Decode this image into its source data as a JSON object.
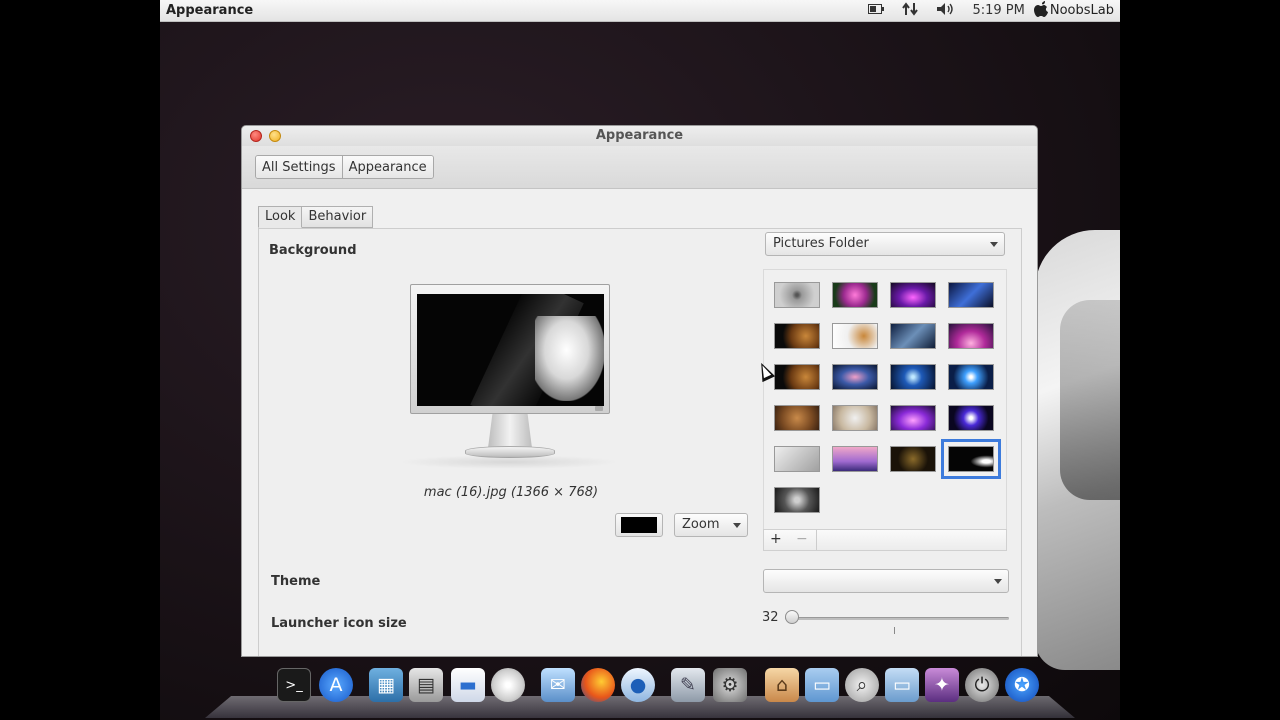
{
  "topbar": {
    "app_name": "Appearance",
    "battery_icon": "battery-icon",
    "network_icon": "network-arrows-icon",
    "volume_icon": "speaker-icon",
    "time": "5:19 PM",
    "user": "NoobsLab"
  },
  "window": {
    "title": "Appearance",
    "breadcrumbs": [
      "All Settings",
      "Appearance"
    ]
  },
  "tabs": [
    {
      "label": "Look",
      "active": true
    },
    {
      "label": "Behavior",
      "active": false
    }
  ],
  "background": {
    "label": "Background",
    "source": "Pictures Folder",
    "preview_caption": "mac (16).jpg (1366 × 768)",
    "color_swatch": "#000000",
    "mode": "Zoom",
    "add_label": "+",
    "remove_label": "−",
    "selected_thumbnail_row": 5,
    "selected_thumbnail_col": 4
  },
  "theme": {
    "label": "Theme",
    "value": ""
  },
  "launcher": {
    "label": "Launcher icon size",
    "value": "32",
    "slider_fraction": 0.0
  },
  "colors": {
    "selection": "#3d7bdc",
    "accent_close": "#e0352b",
    "accent_min": "#f0b020"
  }
}
